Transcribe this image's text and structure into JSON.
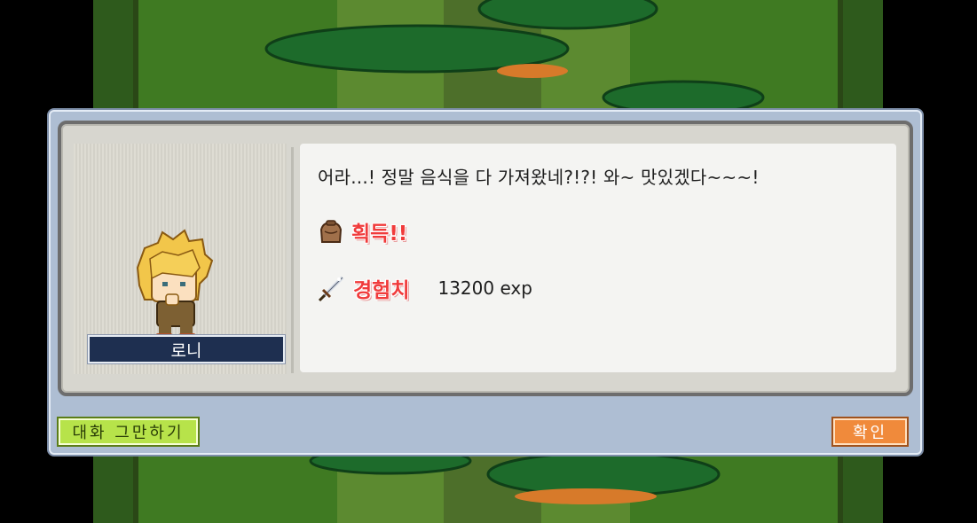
{
  "dialog": {
    "npc_name": "로니",
    "message": "어라...! 정말 음식을 다 가져왔네?!?! 와~ 맛있겠다~~~!",
    "rewards": [
      {
        "label": "획득!!",
        "value": "",
        "icon": "item-bag-icon"
      },
      {
        "label": "경험치",
        "value": "13200 exp",
        "icon": "sword-exp-icon"
      }
    ],
    "buttons": {
      "end_chat": "대화 그만하기",
      "confirm": "확인"
    }
  },
  "colors": {
    "accent_green": "#b7e34a",
    "accent_orange": "#f08a3b",
    "reward_red": "#f03b3b",
    "name_plate": "#1e2f50"
  }
}
